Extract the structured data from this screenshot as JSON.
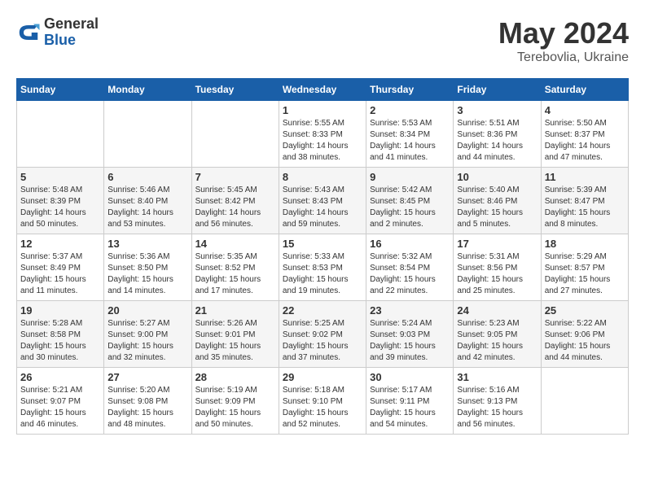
{
  "logo": {
    "general": "General",
    "blue": "Blue"
  },
  "title": "May 2024",
  "location": "Terebovlia, Ukraine",
  "weekdays": [
    "Sunday",
    "Monday",
    "Tuesday",
    "Wednesday",
    "Thursday",
    "Friday",
    "Saturday"
  ],
  "weeks": [
    [
      {
        "day": "",
        "info": ""
      },
      {
        "day": "",
        "info": ""
      },
      {
        "day": "",
        "info": ""
      },
      {
        "day": "1",
        "info": "Sunrise: 5:55 AM\nSunset: 8:33 PM\nDaylight: 14 hours\nand 38 minutes."
      },
      {
        "day": "2",
        "info": "Sunrise: 5:53 AM\nSunset: 8:34 PM\nDaylight: 14 hours\nand 41 minutes."
      },
      {
        "day": "3",
        "info": "Sunrise: 5:51 AM\nSunset: 8:36 PM\nDaylight: 14 hours\nand 44 minutes."
      },
      {
        "day": "4",
        "info": "Sunrise: 5:50 AM\nSunset: 8:37 PM\nDaylight: 14 hours\nand 47 minutes."
      }
    ],
    [
      {
        "day": "5",
        "info": "Sunrise: 5:48 AM\nSunset: 8:39 PM\nDaylight: 14 hours\nand 50 minutes."
      },
      {
        "day": "6",
        "info": "Sunrise: 5:46 AM\nSunset: 8:40 PM\nDaylight: 14 hours\nand 53 minutes."
      },
      {
        "day": "7",
        "info": "Sunrise: 5:45 AM\nSunset: 8:42 PM\nDaylight: 14 hours\nand 56 minutes."
      },
      {
        "day": "8",
        "info": "Sunrise: 5:43 AM\nSunset: 8:43 PM\nDaylight: 14 hours\nand 59 minutes."
      },
      {
        "day": "9",
        "info": "Sunrise: 5:42 AM\nSunset: 8:45 PM\nDaylight: 15 hours\nand 2 minutes."
      },
      {
        "day": "10",
        "info": "Sunrise: 5:40 AM\nSunset: 8:46 PM\nDaylight: 15 hours\nand 5 minutes."
      },
      {
        "day": "11",
        "info": "Sunrise: 5:39 AM\nSunset: 8:47 PM\nDaylight: 15 hours\nand 8 minutes."
      }
    ],
    [
      {
        "day": "12",
        "info": "Sunrise: 5:37 AM\nSunset: 8:49 PM\nDaylight: 15 hours\nand 11 minutes."
      },
      {
        "day": "13",
        "info": "Sunrise: 5:36 AM\nSunset: 8:50 PM\nDaylight: 15 hours\nand 14 minutes."
      },
      {
        "day": "14",
        "info": "Sunrise: 5:35 AM\nSunset: 8:52 PM\nDaylight: 15 hours\nand 17 minutes."
      },
      {
        "day": "15",
        "info": "Sunrise: 5:33 AM\nSunset: 8:53 PM\nDaylight: 15 hours\nand 19 minutes."
      },
      {
        "day": "16",
        "info": "Sunrise: 5:32 AM\nSunset: 8:54 PM\nDaylight: 15 hours\nand 22 minutes."
      },
      {
        "day": "17",
        "info": "Sunrise: 5:31 AM\nSunset: 8:56 PM\nDaylight: 15 hours\nand 25 minutes."
      },
      {
        "day": "18",
        "info": "Sunrise: 5:29 AM\nSunset: 8:57 PM\nDaylight: 15 hours\nand 27 minutes."
      }
    ],
    [
      {
        "day": "19",
        "info": "Sunrise: 5:28 AM\nSunset: 8:58 PM\nDaylight: 15 hours\nand 30 minutes."
      },
      {
        "day": "20",
        "info": "Sunrise: 5:27 AM\nSunset: 9:00 PM\nDaylight: 15 hours\nand 32 minutes."
      },
      {
        "day": "21",
        "info": "Sunrise: 5:26 AM\nSunset: 9:01 PM\nDaylight: 15 hours\nand 35 minutes."
      },
      {
        "day": "22",
        "info": "Sunrise: 5:25 AM\nSunset: 9:02 PM\nDaylight: 15 hours\nand 37 minutes."
      },
      {
        "day": "23",
        "info": "Sunrise: 5:24 AM\nSunset: 9:03 PM\nDaylight: 15 hours\nand 39 minutes."
      },
      {
        "day": "24",
        "info": "Sunrise: 5:23 AM\nSunset: 9:05 PM\nDaylight: 15 hours\nand 42 minutes."
      },
      {
        "day": "25",
        "info": "Sunrise: 5:22 AM\nSunset: 9:06 PM\nDaylight: 15 hours\nand 44 minutes."
      }
    ],
    [
      {
        "day": "26",
        "info": "Sunrise: 5:21 AM\nSunset: 9:07 PM\nDaylight: 15 hours\nand 46 minutes."
      },
      {
        "day": "27",
        "info": "Sunrise: 5:20 AM\nSunset: 9:08 PM\nDaylight: 15 hours\nand 48 minutes."
      },
      {
        "day": "28",
        "info": "Sunrise: 5:19 AM\nSunset: 9:09 PM\nDaylight: 15 hours\nand 50 minutes."
      },
      {
        "day": "29",
        "info": "Sunrise: 5:18 AM\nSunset: 9:10 PM\nDaylight: 15 hours\nand 52 minutes."
      },
      {
        "day": "30",
        "info": "Sunrise: 5:17 AM\nSunset: 9:11 PM\nDaylight: 15 hours\nand 54 minutes."
      },
      {
        "day": "31",
        "info": "Sunrise: 5:16 AM\nSunset: 9:13 PM\nDaylight: 15 hours\nand 56 minutes."
      },
      {
        "day": "",
        "info": ""
      }
    ]
  ]
}
